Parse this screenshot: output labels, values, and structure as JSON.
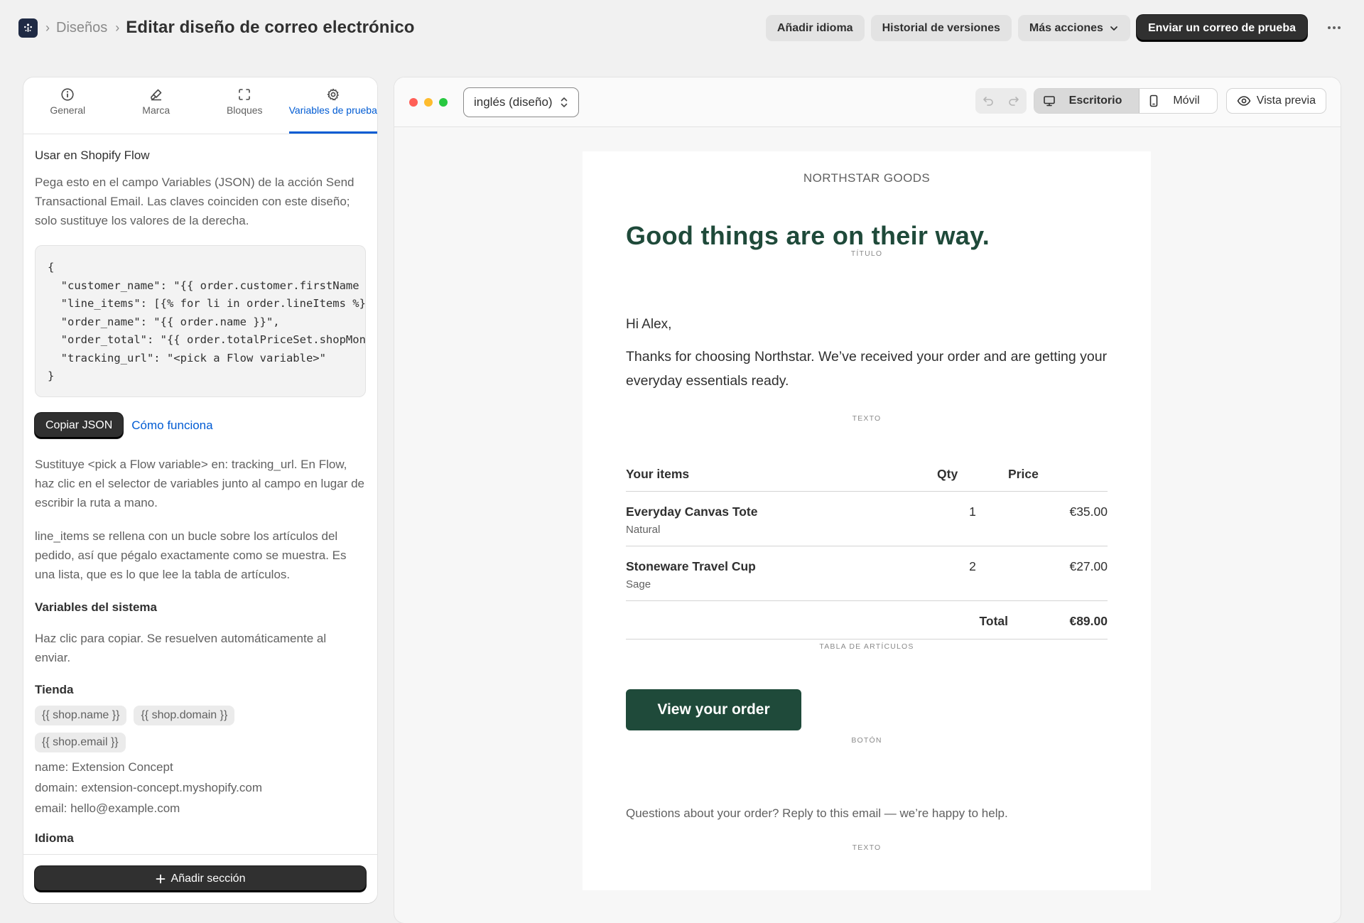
{
  "breadcrumb": {
    "parent": "Diseños",
    "title": "Editar diseño de correo electrónico"
  },
  "top_actions": {
    "add_language": "Añadir idioma",
    "version_history": "Historial de versiones",
    "more_actions": "Más acciones",
    "send_test": "Enviar un correo de prueba"
  },
  "tabs": [
    {
      "label": "General",
      "icon": "info-icon"
    },
    {
      "label": "Marca",
      "icon": "brush-icon"
    },
    {
      "label": "Bloques",
      "icon": "blocks-icon"
    },
    {
      "label": "Variables de prueba",
      "icon": "gear-icon",
      "active": true
    }
  ],
  "panel": {
    "flow_title": "Usar en Shopify Flow",
    "flow_desc": "Pega esto en el campo Variables (JSON) de la acción Send Transactional Email. Las claves coinciden con este diseño; solo sustituye los valores de la derecha.",
    "code": "{\n  \"customer_name\": \"{{ order.customer.firstName }}\",\n  \"line_items\": [{% for li in order.lineItems %}...],\n  \"order_name\": \"{{ order.name }}\",\n  \"order_total\": \"{{ order.totalPriceSet.shopMoney.amount }}\",\n  \"tracking_url\": \"<pick a Flow variable>\"\n}",
    "copy_json": "Copiar JSON",
    "how_it_works": "Cómo funciona",
    "replace_note": "Sustituye <pick a Flow variable> en: tracking_url. En Flow, haz clic en el selector de variables junto al campo en lugar de escribir la ruta a mano.",
    "line_items_note": "line_items se rellena con un bucle sobre los artículos del pedido, así que pégalo exactamente como se muestra. Es una lista, que es lo que lee la tabla de artículos.",
    "system_vars_title": "Variables del sistema",
    "system_vars_desc": "Haz clic para copiar. Se resuelven automáticamente al enviar.",
    "store_title": "Tienda",
    "store_chips": [
      "{{ shop.name }}",
      "{{ shop.domain }}",
      "{{ shop.email }}"
    ],
    "store_values": {
      "name": "name: Extension Concept",
      "domain": "domain: extension-concept.myshopify.com",
      "email": "email: hello@example.com"
    },
    "language_title": "Idioma",
    "add_section": "Añadir sección"
  },
  "canvas_toolbar": {
    "language": "inglés (diseño)",
    "desktop": "Escritorio",
    "mobile": "Móvil",
    "preview": "Vista previa"
  },
  "email": {
    "brand": "NORTHSTAR GOODS",
    "headline": "Good things are on their way.",
    "label_title": "TÍTULO",
    "greeting": "Hi Alex,",
    "body": "Thanks for choosing Northstar. We’ve received your order and are getting your everyday essentials ready.",
    "label_text": "TEXTO",
    "table": {
      "headers": {
        "item": "Your items",
        "qty": "Qty",
        "price": "Price"
      },
      "rows": [
        {
          "name": "Everyday Canvas Tote",
          "variant": "Natural",
          "qty": "1",
          "price": "€35.00"
        },
        {
          "name": "Stoneware Travel Cup",
          "variant": "Sage",
          "qty": "2",
          "price": "€27.00"
        }
      ],
      "total_label": "Total",
      "total_value": "€89.00"
    },
    "label_table": "TABLA DE ARTÍCULOS",
    "cta": "View your order",
    "label_button": "BOTÓN",
    "footer": "Questions about your order? Reply to this email — we’re happy to help.",
    "label_text2": "TEXTO"
  },
  "colors": {
    "accent": "#005bd3",
    "brand_green": "#1f4a3a",
    "dark_button": "#303030"
  }
}
